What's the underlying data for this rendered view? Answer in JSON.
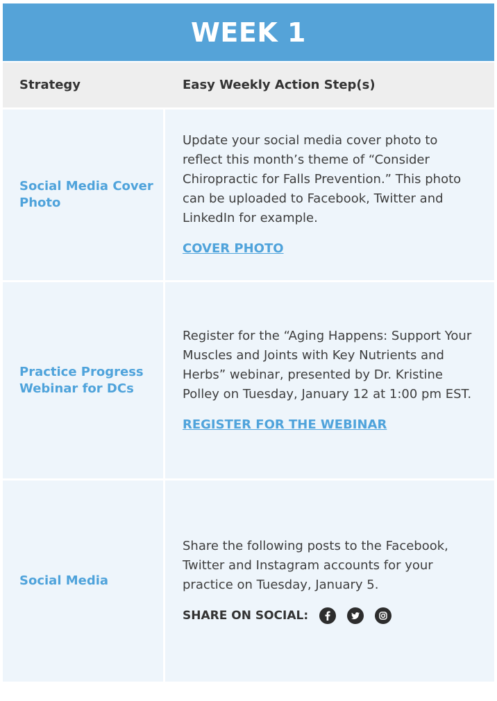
{
  "title": "WEEK 1",
  "headers": {
    "strategy": "Strategy",
    "action": "Easy Weekly Action Step(s)"
  },
  "rows": [
    {
      "strategy": "Social Media Cover Photo",
      "description": "Update your social media cover photo to reflect this month’s theme of “Consider Chiropractic for Falls Prevention.” This photo can be uploaded to Facebook, Twitter and LinkedIn for example.",
      "link": "COVER PHOTO"
    },
    {
      "strategy": "Practice Progress Webinar for DCs",
      "description": "Register for the “Aging Happens: Support Your Muscles and Joints with Key Nutrients and Herbs” webinar, presented by Dr. Kristine Polley on Tuesday, January 12 at 1:00 pm EST.",
      "link": "REGISTER FOR THE WEBINAR"
    },
    {
      "strategy": "Social Media",
      "description": "Share the following posts to the Facebook, Twitter and Instagram accounts for your practice on Tuesday, January 5.",
      "share_label": "SHARE ON SOCIAL:",
      "icons": [
        "facebook-icon",
        "twitter-icon",
        "instagram-icon"
      ]
    }
  ],
  "colors": {
    "title_bar": "#55a3d8",
    "accent_text": "#4fa3db",
    "header_bg": "#eeeeee",
    "row_bg": "#eef5fb"
  }
}
